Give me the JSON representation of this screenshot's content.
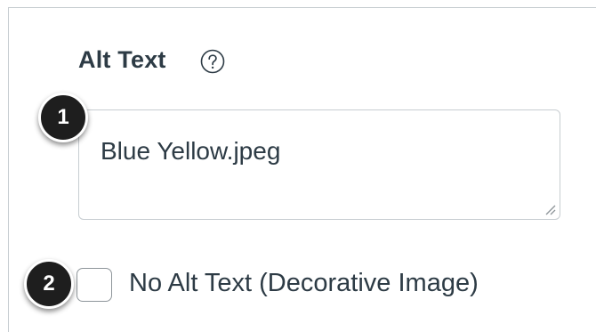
{
  "alt_text": {
    "label": "Alt Text",
    "help_icon": "question-circle-icon",
    "value": "Blue Yellow.jpeg"
  },
  "decorative": {
    "checked": false,
    "label": "No Alt Text (Decorative Image)"
  },
  "callouts": [
    "1",
    "2"
  ],
  "colors": {
    "text": "#2d3b45",
    "border": "#c7cdd1",
    "callout_bg": "#1e1e1e"
  }
}
